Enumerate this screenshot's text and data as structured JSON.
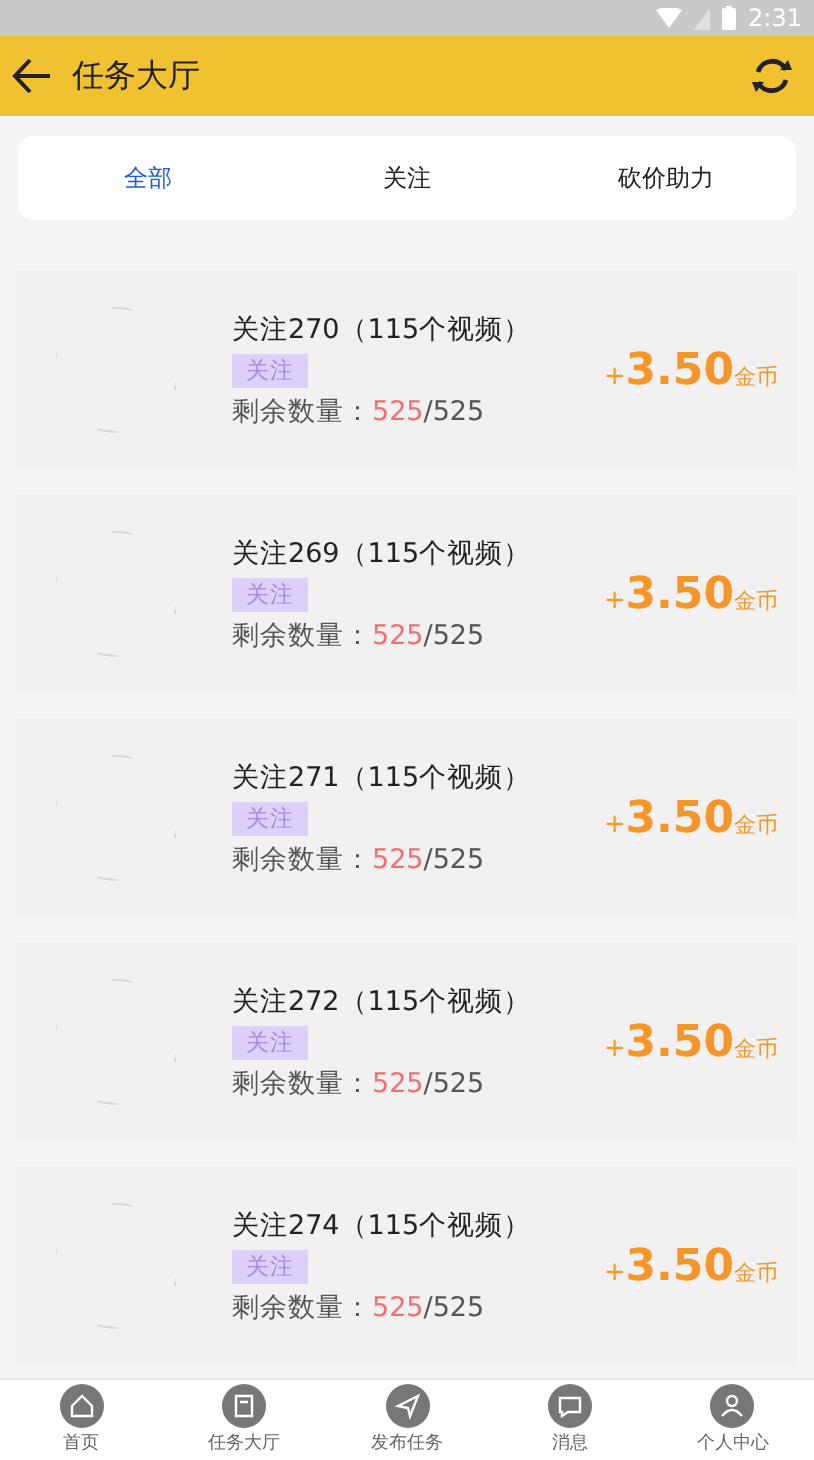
{
  "status_bar": {
    "time": "2:31"
  },
  "header": {
    "title": "任务大厅"
  },
  "tabs": [
    {
      "label": "全部",
      "selected": true
    },
    {
      "label": "关注",
      "selected": false
    },
    {
      "label": "砍价助力",
      "selected": false
    }
  ],
  "tasks": [
    {
      "title": "关注270（115个视频）",
      "tag": "关注",
      "remaining_label": "剩余数量：",
      "remaining": "525",
      "total": "/525",
      "reward_sign": "+",
      "reward": "3.50",
      "reward_unit": "金币"
    },
    {
      "title": "关注269（115个视频）",
      "tag": "关注",
      "remaining_label": "剩余数量：",
      "remaining": "525",
      "total": "/525",
      "reward_sign": "+",
      "reward": "3.50",
      "reward_unit": "金币"
    },
    {
      "title": "关注271（115个视频）",
      "tag": "关注",
      "remaining_label": "剩余数量：",
      "remaining": "525",
      "total": "/525",
      "reward_sign": "+",
      "reward": "3.50",
      "reward_unit": "金币"
    },
    {
      "title": "关注272（115个视频）",
      "tag": "关注",
      "remaining_label": "剩余数量：",
      "remaining": "525",
      "total": "/525",
      "reward_sign": "+",
      "reward": "3.50",
      "reward_unit": "金币"
    },
    {
      "title": "关注274（115个视频）",
      "tag": "关注",
      "remaining_label": "剩余数量：",
      "remaining": "525",
      "total": "/525",
      "reward_sign": "+",
      "reward": "3.50",
      "reward_unit": "金币"
    }
  ],
  "bottom_nav": [
    {
      "label": "首页",
      "kind": "home"
    },
    {
      "label": "任务大厅",
      "kind": "tasks"
    },
    {
      "label": "发布任务",
      "kind": "publish"
    },
    {
      "label": "消息",
      "kind": "message"
    },
    {
      "label": "个人中心",
      "kind": "profile"
    }
  ]
}
